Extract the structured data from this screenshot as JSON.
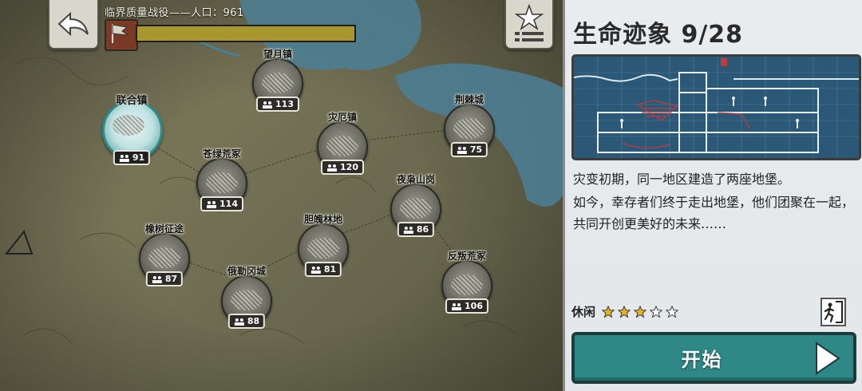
{
  "campaign": {
    "title": "临界质量战役——人口：961",
    "progress": 1.0
  },
  "icons": {
    "back": "back-arrow-icon",
    "star_menu": "star-list-icon",
    "flag": "flag-icon",
    "people": "people-icon",
    "exit": "exit-door-icon",
    "play": "play-arrow-icon"
  },
  "towns": [
    {
      "name": "联合镇",
      "population": "91",
      "selected": true
    },
    {
      "name": "望月镇",
      "population": "113"
    },
    {
      "name": "荆棘城",
      "population": "75"
    },
    {
      "name": "灾厄镇",
      "population": "120"
    },
    {
      "name": "苍绿荒冢",
      "population": "114"
    },
    {
      "name": "夜枭山岗",
      "population": "86"
    },
    {
      "name": "橡树征途",
      "population": "87"
    },
    {
      "name": "胆魄林地",
      "population": "81"
    },
    {
      "name": "反叛荒冢",
      "population": "106"
    },
    {
      "name": "俄勒冈城",
      "population": "88"
    }
  ],
  "panel": {
    "title": "生命迹象 9/28",
    "description_1": "灾变初期，同一地区建造了两座地堡。",
    "description_2": "如今，幸存者们终于走出地堡，他们团聚在一起，共同开创更美好的未来……",
    "difficulty_label": "休闲",
    "difficulty_stars": 3,
    "difficulty_max": 5,
    "start_label": "开始"
  },
  "colors": {
    "accent_teal": "#2e8886",
    "star_gold": "#e6b422",
    "progress": "#a8962e"
  }
}
